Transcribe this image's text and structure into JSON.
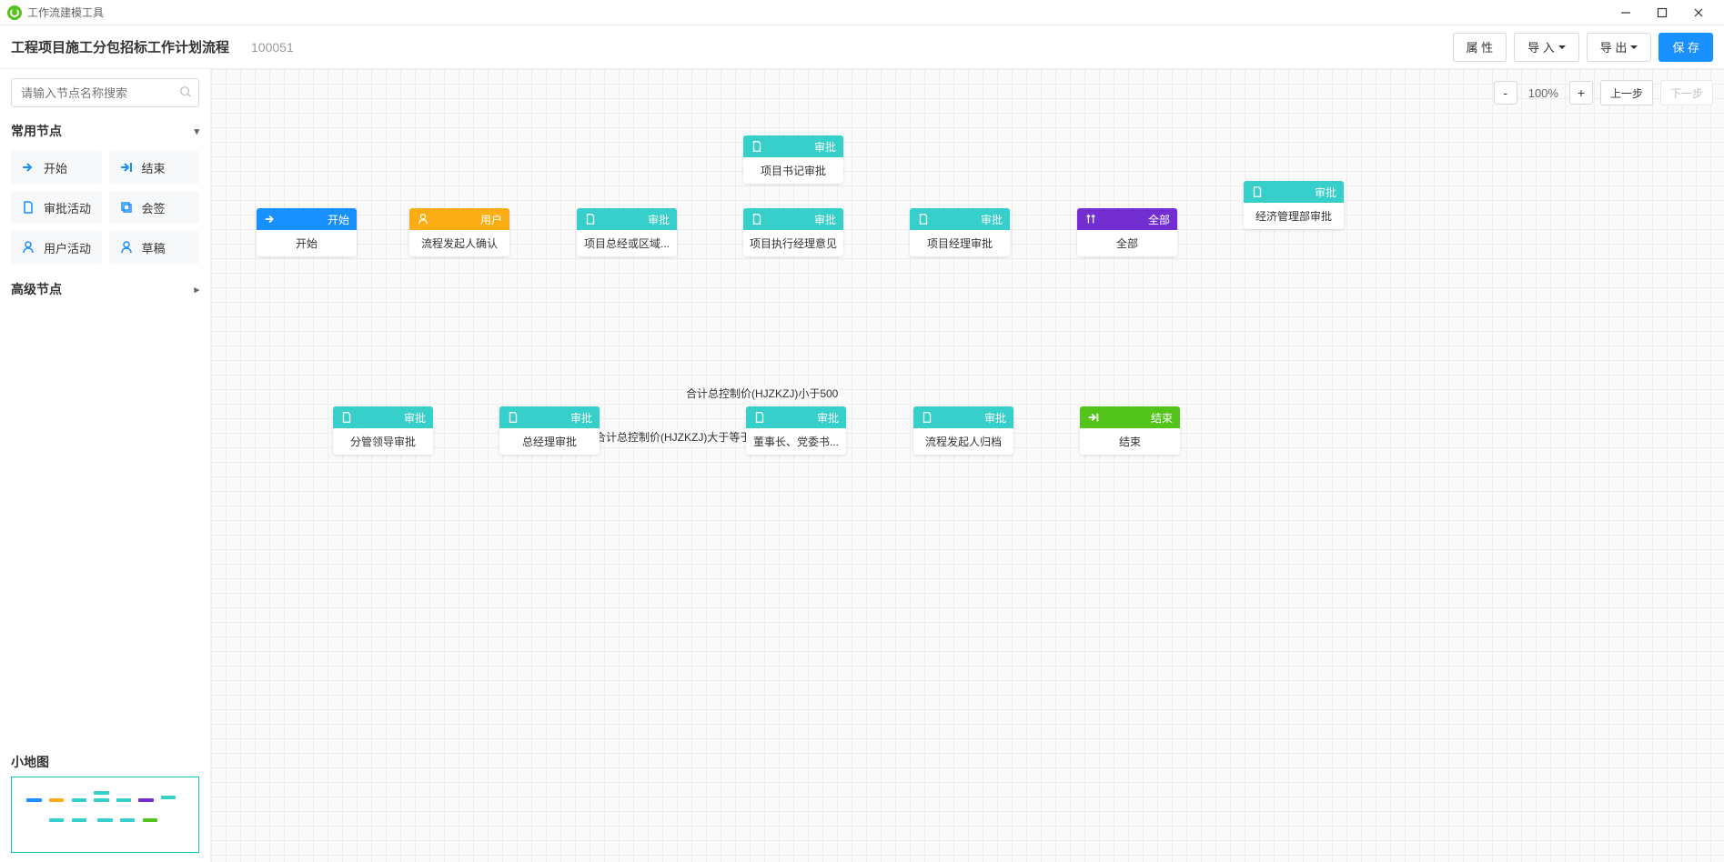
{
  "app": {
    "title": "工作流建模工具"
  },
  "header": {
    "flow_name": "工程项目施工分包招标工作计划流程",
    "flow_code": "100051",
    "btn_props": "属 性",
    "btn_import": "导 入",
    "btn_export": "导 出",
    "btn_save": "保 存"
  },
  "sidebar": {
    "search_placeholder": "请输入节点名称搜索",
    "panel_common": "常用节点",
    "panel_advanced": "高级节点",
    "items": {
      "start": "开始",
      "end": "结束",
      "approve": "审批活动",
      "countersign": "会签",
      "user": "用户活动",
      "draft": "草稿"
    },
    "minimap_title": "小地图"
  },
  "canvas": {
    "zoom": "100%",
    "btn_prev": "上一步",
    "btn_next": "下一步",
    "nodes": {
      "n1": {
        "type": "start",
        "header": "开始",
        "body": "开始"
      },
      "n2": {
        "type": "user",
        "header": "用户",
        "body": "流程发起人确认"
      },
      "n3": {
        "type": "approve",
        "header": "审批",
        "body": "项目总经或区域..."
      },
      "n4": {
        "type": "approve",
        "header": "审批",
        "body": "项目书记审批"
      },
      "n5": {
        "type": "approve",
        "header": "审批",
        "body": "项目执行经理意见"
      },
      "n6": {
        "type": "approve",
        "header": "审批",
        "body": "项目经理审批"
      },
      "n7": {
        "type": "gateway",
        "header": "全部",
        "body": "全部"
      },
      "n8": {
        "type": "approve",
        "header": "审批",
        "body": "经济管理部审批"
      },
      "n9": {
        "type": "approve",
        "header": "审批",
        "body": "分管领导审批"
      },
      "n10": {
        "type": "approve",
        "header": "审批",
        "body": "总经理审批"
      },
      "n11": {
        "type": "approve",
        "header": "审批",
        "body": "董事长、党委书..."
      },
      "n12": {
        "type": "approve",
        "header": "审批",
        "body": "流程发起人归档"
      },
      "n13": {
        "type": "end",
        "header": "结束",
        "body": "结束"
      }
    },
    "edge_labels": {
      "e_lt500": "合计总控制价(HJZKZJ)小于500",
      "e_ge500": "合计总控制价(HJZKZJ)大于等于500"
    }
  }
}
